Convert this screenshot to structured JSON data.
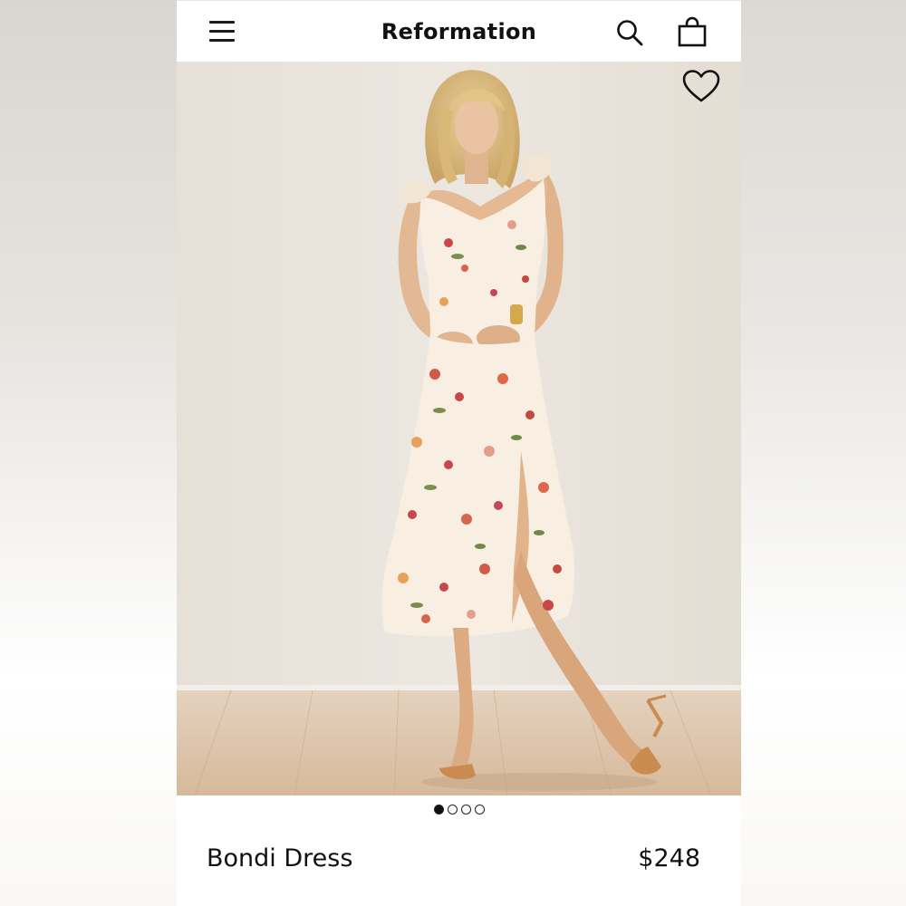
{
  "header": {
    "brand": "Reformation",
    "menu_icon": "hamburger-menu-icon",
    "search_icon": "search-icon",
    "bag_icon": "shopping-bag-icon"
  },
  "hero": {
    "favorite_icon": "heart-outline-icon",
    "image_subject": "product-photo",
    "carousel": {
      "total": 4,
      "active_index": 0
    }
  },
  "product": {
    "name": "Bondi Dress",
    "price": "$248"
  },
  "colors": {
    "text": "#111111",
    "background": "#ffffff",
    "wall": "#e9e4dd",
    "floor": "#dcc3a8",
    "dress": "#f8efe2"
  }
}
